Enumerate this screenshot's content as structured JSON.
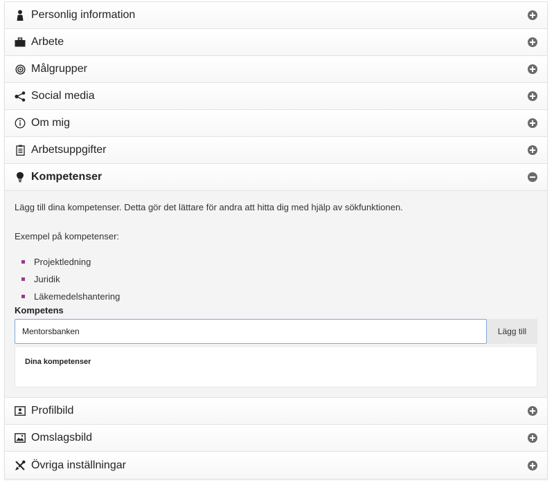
{
  "sections": [
    {
      "key": "personal",
      "label": "Personlig information",
      "icon": "person-icon",
      "state": "collapsed"
    },
    {
      "key": "work",
      "label": "Arbete",
      "icon": "briefcase-icon",
      "state": "collapsed"
    },
    {
      "key": "target",
      "label": "Målgrupper",
      "icon": "target-icon",
      "state": "collapsed"
    },
    {
      "key": "social",
      "label": "Social media",
      "icon": "share-icon",
      "state": "collapsed"
    },
    {
      "key": "about",
      "label": "Om mig",
      "icon": "info-icon",
      "state": "collapsed"
    },
    {
      "key": "tasks",
      "label": "Arbetsuppgifter",
      "icon": "clipboard-icon",
      "state": "collapsed"
    },
    {
      "key": "skills",
      "label": "Kompetenser",
      "icon": "lightbulb-icon",
      "state": "expanded"
    },
    {
      "key": "profile_pic",
      "label": "Profilbild",
      "icon": "portrait-icon",
      "state": "collapsed"
    },
    {
      "key": "cover_pic",
      "label": "Omslagsbild",
      "icon": "picture-icon",
      "state": "collapsed"
    },
    {
      "key": "other",
      "label": "Övriga inställningar",
      "icon": "tools-icon",
      "state": "collapsed"
    }
  ],
  "skills_panel": {
    "intro": "Lägg till dina kompetenser. Detta gör det lättare för andra att hitta dig med hjälp av sökfunktionen.",
    "examples_label": "Exempel på kompetenser:",
    "examples": [
      "Projektledning",
      "Juridik",
      "Läkemedelshantering"
    ],
    "field_label": "Kompetens",
    "input_value": "Mentorsbanken",
    "add_button": "Lägg till",
    "my_skills_title": "Dina kompetenser"
  },
  "colors": {
    "bullet": "#9a3a8a",
    "input_border": "#7fa6d8",
    "toggle": "#6a6a6a"
  }
}
